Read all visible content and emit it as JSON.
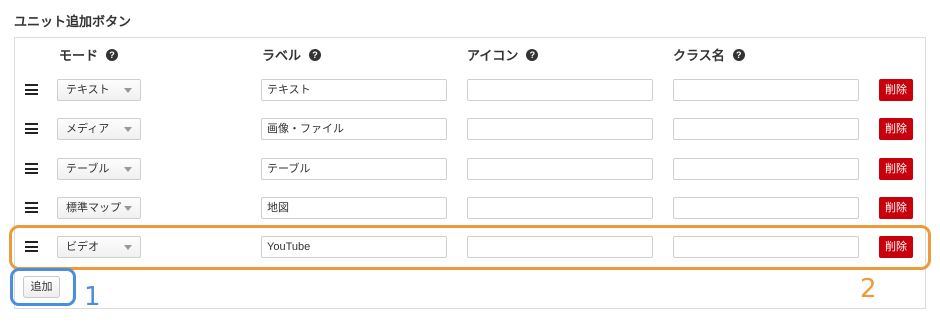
{
  "section_title": "ユニット追加ボタン",
  "columns": {
    "mode": "モード",
    "label": "ラベル",
    "icon": "アイコン",
    "class_name": "クラス名",
    "help_glyph": "?"
  },
  "rows": [
    {
      "mode": "テキスト",
      "label": "テキスト",
      "icon": "",
      "class_name": "",
      "delete": "削除"
    },
    {
      "mode": "メディア",
      "label": "画像・ファイル",
      "icon": "",
      "class_name": "",
      "delete": "削除"
    },
    {
      "mode": "テーブル",
      "label": "テーブル",
      "icon": "",
      "class_name": "",
      "delete": "削除"
    },
    {
      "mode": "標準マップ",
      "label": "地図",
      "icon": "",
      "class_name": "",
      "delete": "削除"
    },
    {
      "mode": "ビデオ",
      "label": "YouTube",
      "icon": "",
      "class_name": "",
      "delete": "削除"
    }
  ],
  "add_button_label": "追加",
  "annotations": {
    "marker_1": "1",
    "marker_2": "2",
    "marker_1_color": "#4a8ee0",
    "marker_2_color": "#ec9a3a"
  },
  "colors": {
    "delete_button": "#c8000b"
  },
  "icons": {
    "drag_handle": "hamburger-icon",
    "help": "question-circle-icon",
    "select_caret": "caret-down-icon"
  }
}
